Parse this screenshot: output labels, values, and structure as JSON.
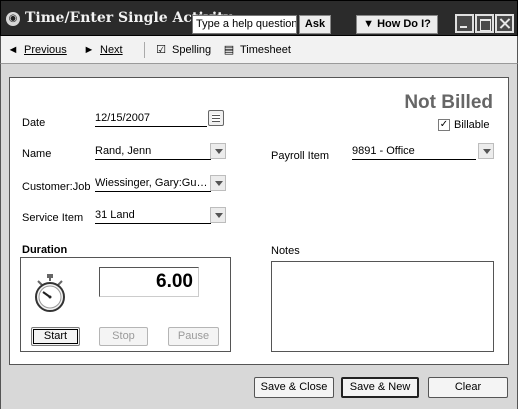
{
  "window": {
    "title": "Time/Enter Single Activity",
    "help_placeholder": "Type a help question",
    "ask_label": "Ask",
    "howdoi_label": "How Do I?"
  },
  "toolbar": {
    "previous": "Previous",
    "next": "Next",
    "spelling": "Spelling",
    "timesheet": "Timesheet"
  },
  "status": {
    "text": "Not Billed",
    "billable_label": "Billable",
    "billable_checked": true
  },
  "fields": {
    "date_label": "Date",
    "date_value": "12/15/2007",
    "name_label": "Name",
    "name_value": "Rand, Jenn",
    "customer_label": "Customer:Job",
    "customer_value": "Wiessinger, Gary:Gu…",
    "service_label": "Service Item",
    "service_value": "31 Land",
    "payroll_label": "Payroll Item",
    "payroll_value": "9891 - Office"
  },
  "duration": {
    "title": "Duration",
    "hours": "6.00",
    "start_label": "Start",
    "stop_label": "Stop",
    "pause_label": "Pause"
  },
  "notes": {
    "title": "Notes",
    "value": ""
  },
  "actions": {
    "save_close": "Save & Close",
    "save_new": "Save & New",
    "clear": "Clear"
  }
}
